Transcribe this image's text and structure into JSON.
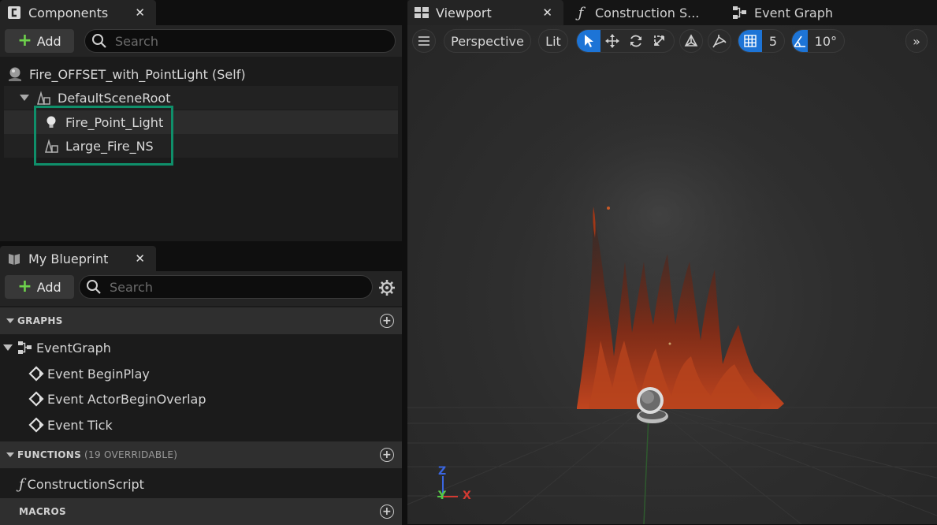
{
  "left_tabs": {
    "components": {
      "label": "Components",
      "close": "✕"
    },
    "my_blueprint": {
      "label": "My Blueprint",
      "close": "✕"
    }
  },
  "components_panel": {
    "add_label": "Add",
    "search_placeholder": "Search",
    "tree": [
      {
        "label": "Fire_OFFSET_with_PointLight (Self)"
      },
      {
        "label": "DefaultSceneRoot"
      },
      {
        "label": "Fire_Point_Light"
      },
      {
        "label": "Large_Fire_NS"
      }
    ]
  },
  "blueprint_panel": {
    "add_label": "Add",
    "search_placeholder": "Search",
    "graphs_header": "GRAPHS",
    "event_graph": "EventGraph",
    "events": [
      "Event BeginPlay",
      "Event ActorBeginOverlap",
      "Event Tick"
    ],
    "functions_header": "FUNCTIONS",
    "functions_sub": "(19 OVERRIDABLE)",
    "construction_script": "ConstructionScript",
    "macros_header": "MACROS"
  },
  "right_tabs": {
    "viewport": {
      "label": "Viewport",
      "close": "✕"
    },
    "construction": {
      "label": "Construction S..."
    },
    "event_graph": {
      "label": "Event Graph"
    }
  },
  "viewport_toolbar": {
    "perspective": "Perspective",
    "lit": "Lit",
    "grid_snap": "5",
    "rotation_snap": "10°",
    "expand": "»"
  },
  "axis_labels": {
    "z": "Z",
    "y": "Y",
    "x": "X"
  },
  "colors": {
    "selection_outline": "#0f8f6a",
    "accent_blue": "#1d74d6",
    "add_plus": "#6ed24c",
    "axis_x": "#d23a32",
    "axis_y": "#56c847",
    "axis_z": "#3a66e0"
  }
}
